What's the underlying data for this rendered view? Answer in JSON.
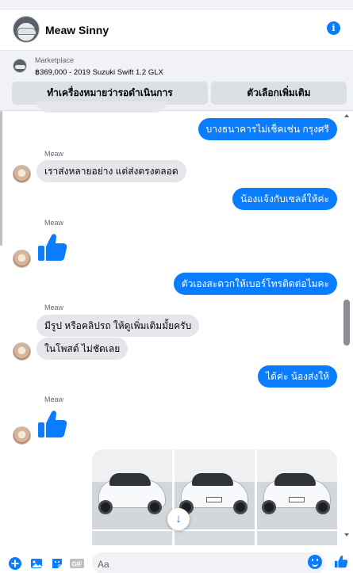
{
  "header": {
    "title": "Meaw Sinny",
    "info_icon": "info-icon"
  },
  "listing": {
    "label": "Marketplace",
    "item": "฿369,000 - 2019 Suzuki Swift 1.2 GLX",
    "mark_button": "ทำเครื่องหมายว่ารอดำเนินการ",
    "more_button": "ตัวเลือกเพิ่มเติม"
  },
  "messages": [
    {
      "dir": "out",
      "text": "บางธนาคารไม่เช็คเช่น กรุงศรี"
    },
    {
      "dir": "in",
      "sender": "Meaw",
      "text": "เราส่งหลายอย่าง แต่ส่งตรงตลอด"
    },
    {
      "dir": "out",
      "text": "น้องแจ้งกับเซลล์ให้ค่ะ"
    },
    {
      "dir": "in",
      "sender": "Meaw",
      "sticker": "thumbs-up-icon"
    },
    {
      "dir": "out",
      "text": "ตัวเองสะดวกให้เบอร์โทรติดต่อไมคะ"
    },
    {
      "dir": "in",
      "sender": "Meaw",
      "text": "มีรูป หรือคลิปรถ ให้ดูเพิ่มเติมมั้ยครับ"
    },
    {
      "dir": "in",
      "text": "ในโพสต์ ไม่ชัดเลย"
    },
    {
      "dir": "out",
      "text": "ได้ค่ะ น้องส่งให้"
    },
    {
      "dir": "in",
      "sender": "Meaw",
      "sticker": "thumbs-up-icon"
    }
  ],
  "composer": {
    "placeholder": "Aa"
  },
  "colors": {
    "accent": "#0a7cff",
    "incoming": "#e4e6eb",
    "listing_bg": "#f0f2f5"
  }
}
